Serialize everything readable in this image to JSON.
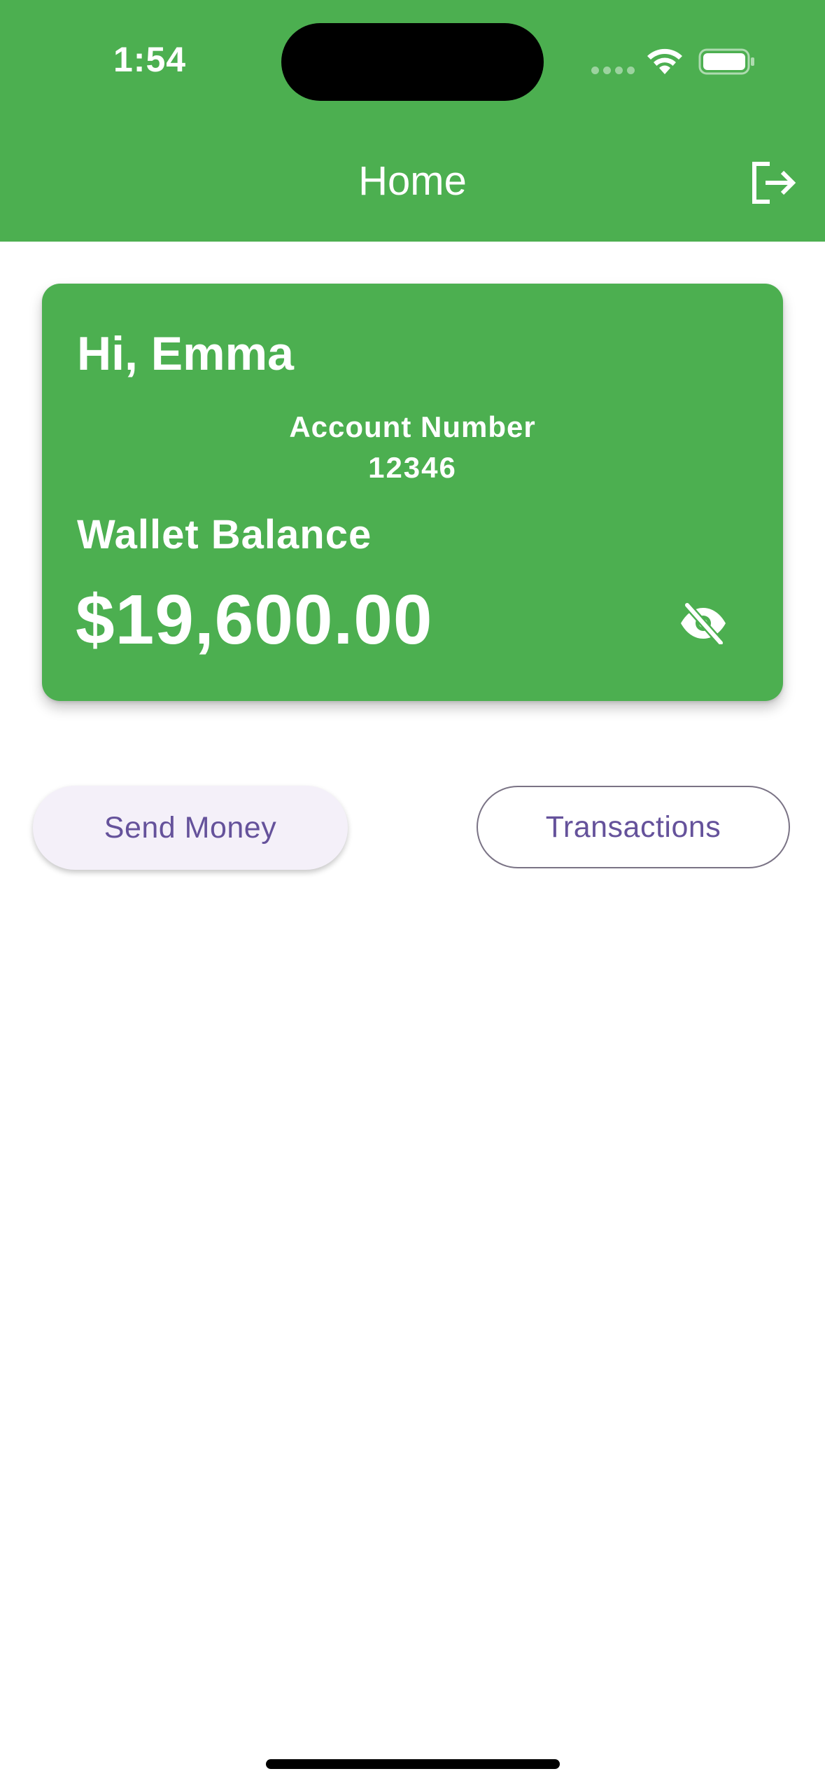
{
  "status_bar": {
    "time": "1:54",
    "icons": [
      "signal-icon",
      "wifi-icon",
      "battery-icon"
    ]
  },
  "header": {
    "title": "Home",
    "action_icon": "logout-icon"
  },
  "balance_card": {
    "greeting": "Hi, Emma",
    "account_label": "Account Number",
    "account_number": "12346",
    "wallet_label": "Wallet Balance",
    "wallet_amount": "$19,600.00",
    "toggle_icon": "eye-off-icon"
  },
  "actions": {
    "send_money_label": "Send Money",
    "transactions_label": "Transactions"
  },
  "colors": {
    "primary": "#4caf50",
    "button_text": "#65529b",
    "tonal_button_bg": "#f4f0f9",
    "outline": "#7a7385"
  }
}
